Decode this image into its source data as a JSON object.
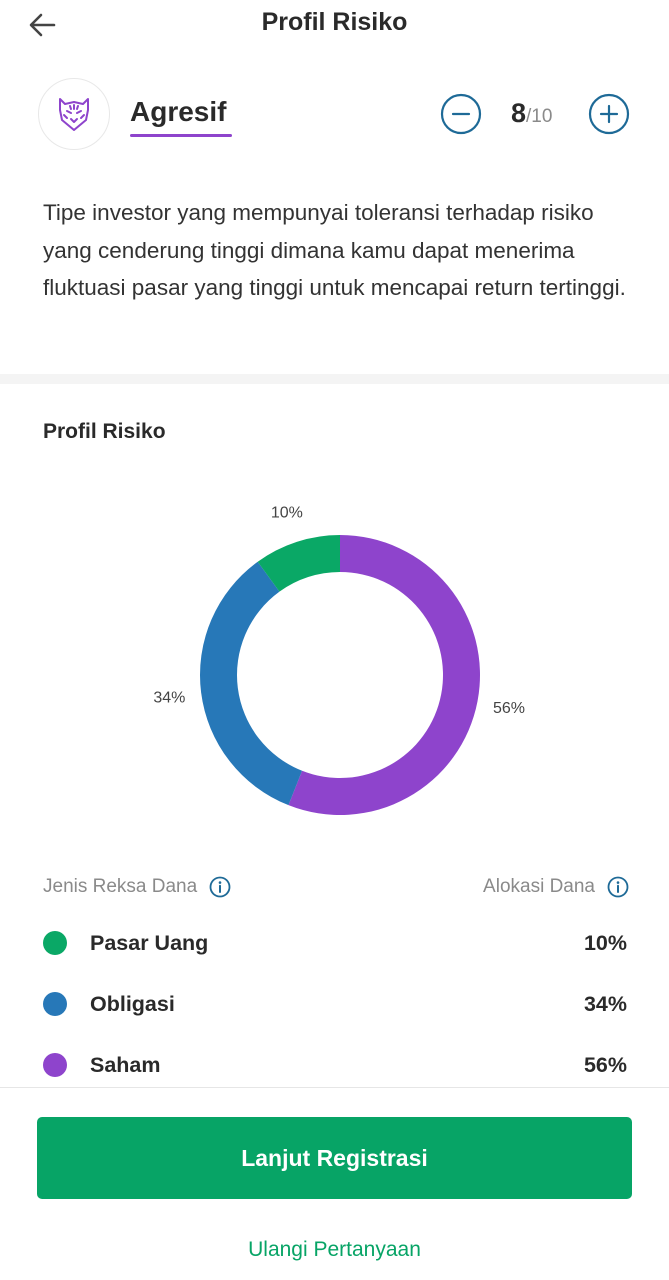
{
  "header": {
    "title": "Profil Risiko"
  },
  "profile": {
    "name": "Agresif",
    "score": "8",
    "score_total": "/10"
  },
  "description": "Tipe investor yang mempunyai toleransi terhadap risiko yang cenderung tinggi dimana kamu dapat menerima fluktuasi pasar yang tinggi untuk mencapai return tertinggi.",
  "section": {
    "title": "Profil Risiko"
  },
  "colors": {
    "accent_purple": "#8e44cc",
    "brand_green": "#07a466",
    "obligasi_blue": "#2778b8"
  },
  "chart_data": {
    "type": "pie",
    "donut": true,
    "categories": [
      "Pasar Uang",
      "Obligasi",
      "Saham"
    ],
    "values": [
      10,
      34,
      56
    ],
    "labels": [
      "10%",
      "34%",
      "56%"
    ],
    "colors": [
      "#0aa866",
      "#2778b8",
      "#8e44cc"
    ]
  },
  "legend": {
    "left_header": "Jenis Reksa Dana",
    "right_header": "Alokasi Dana",
    "items": [
      {
        "label": "Pasar Uang",
        "value": "10%"
      },
      {
        "label": "Obligasi",
        "value": "34%"
      },
      {
        "label": "Saham",
        "value": "56%"
      }
    ]
  },
  "actions": {
    "primary": "Lanjut Registrasi",
    "secondary": "Ulangi Pertanyaan"
  }
}
